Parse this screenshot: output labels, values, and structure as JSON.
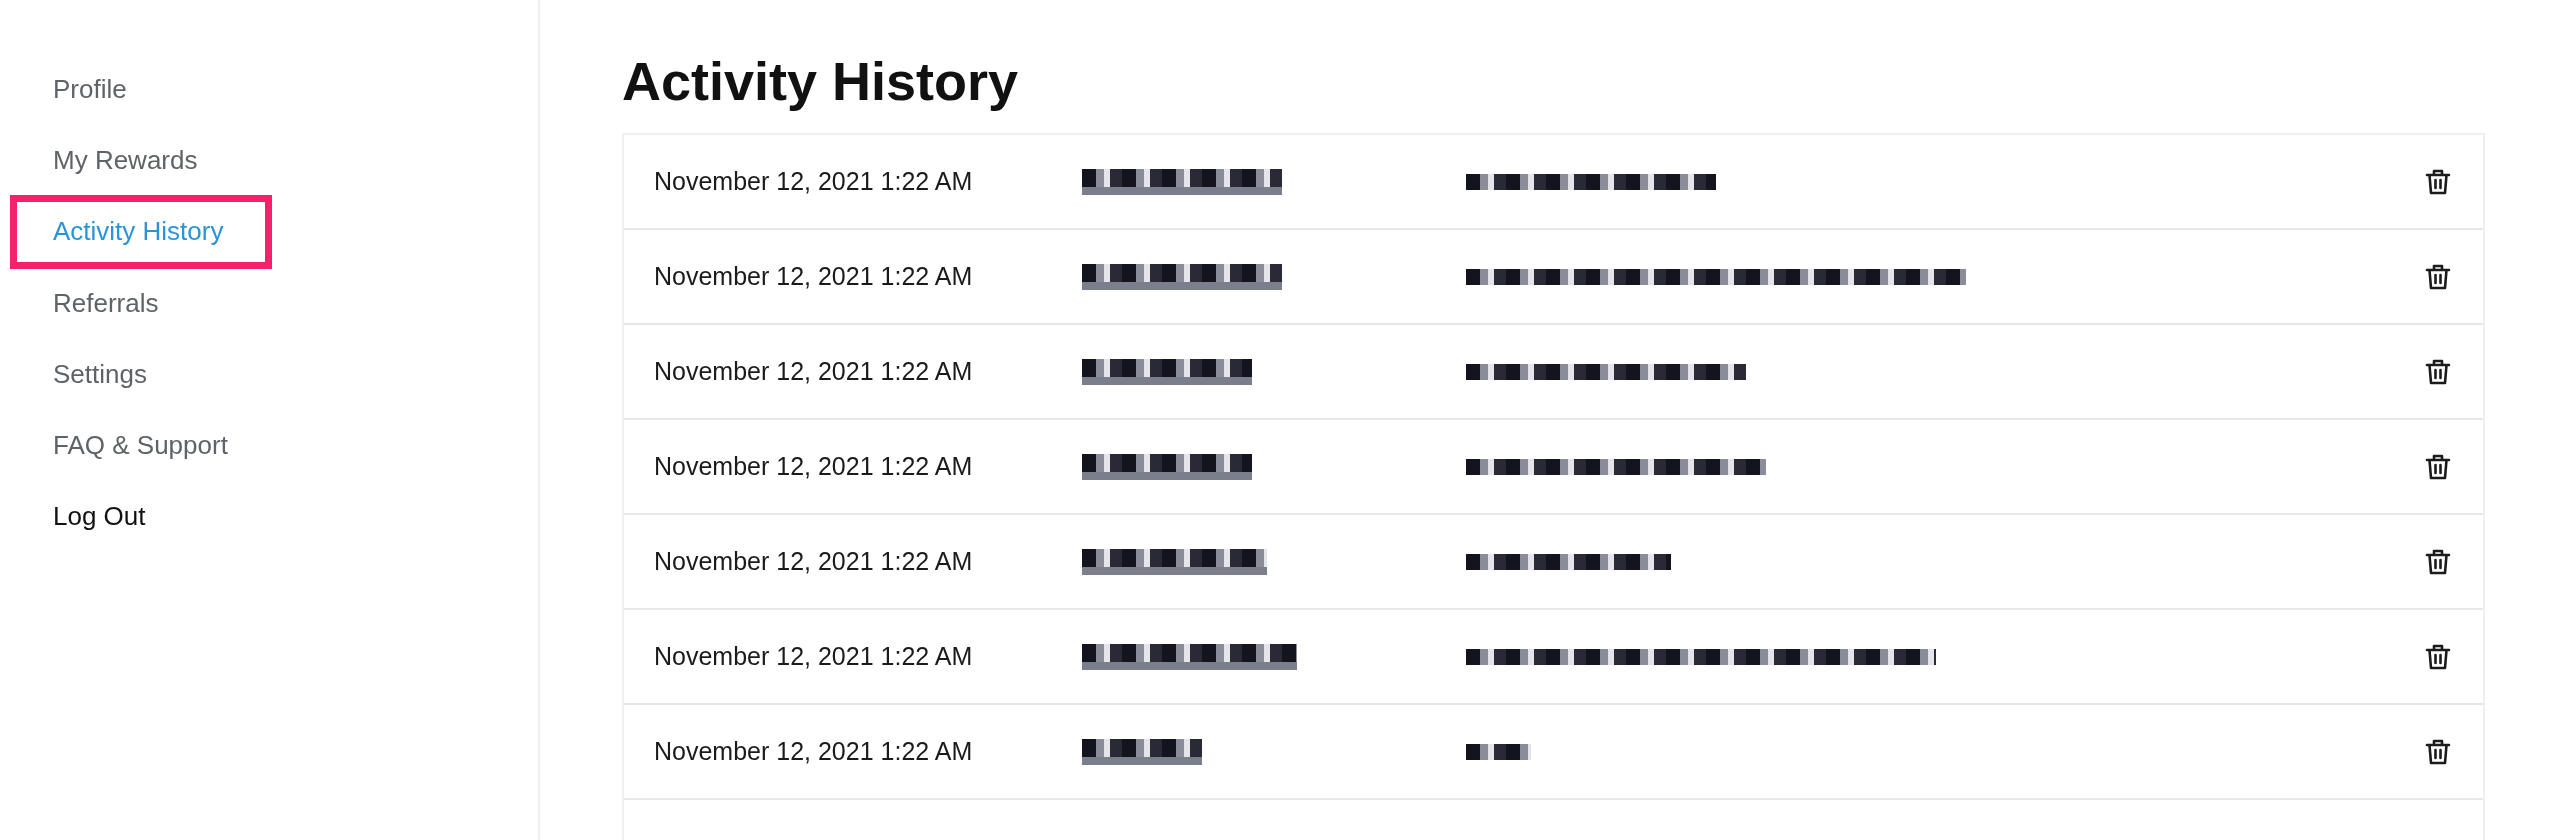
{
  "sidebar": {
    "items": [
      {
        "label": "Profile",
        "selected": false,
        "kind": "link"
      },
      {
        "label": "My Rewards",
        "selected": false,
        "kind": "link"
      },
      {
        "label": "Activity History",
        "selected": true,
        "kind": "link"
      },
      {
        "label": "Referrals",
        "selected": false,
        "kind": "link"
      },
      {
        "label": "Settings",
        "selected": false,
        "kind": "link"
      },
      {
        "label": "FAQ & Support",
        "selected": false,
        "kind": "link"
      },
      {
        "label": "Log Out",
        "selected": false,
        "kind": "action"
      }
    ]
  },
  "page_title": "Activity History",
  "activity": {
    "rows": [
      {
        "date": "November 12, 2021 1:22 AM"
      },
      {
        "date": "November 12, 2021 1:22 AM"
      },
      {
        "date": "November 12, 2021 1:22 AM"
      },
      {
        "date": "November 12, 2021 1:22 AM"
      },
      {
        "date": "November 12, 2021 1:22 AM"
      },
      {
        "date": "November 12, 2021 1:22 AM"
      },
      {
        "date": "November 12, 2021 1:22 AM"
      }
    ]
  }
}
